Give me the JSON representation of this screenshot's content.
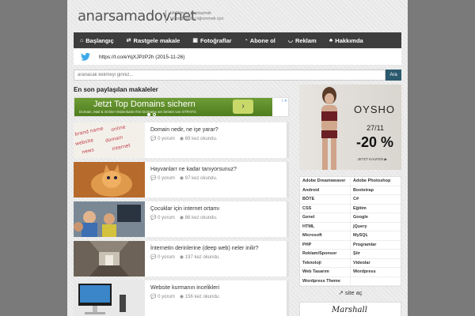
{
  "header": {
    "logo": "anarsamadov.net",
    "tagline_line1": "bildiklerini paylaşmak",
    "tagline_line2": "bilmediklerini öğrenmek için"
  },
  "nav": {
    "items": [
      {
        "label": "Başlangıç",
        "icon": "home-icon"
      },
      {
        "label": "Rastgele makale",
        "icon": "shuffle-icon"
      },
      {
        "label": "Fotoğraflar",
        "icon": "photo-icon"
      },
      {
        "label": "Abone ol",
        "icon": "rss-icon"
      },
      {
        "label": "Reklam",
        "icon": "megaphone-icon"
      },
      {
        "label": "Hakkımda",
        "icon": "users-icon"
      }
    ]
  },
  "tweet": {
    "text": "https://t.co/eYqXJPzP2h (2015-11-26)",
    "icon": "twitter-bird-icon"
  },
  "search": {
    "placeholder": "aranacak kelimeyi giriniz...",
    "button_label": "Ara"
  },
  "section_title": "En son paylaşılan makaleler",
  "ad_banner": {
    "title": "Jetzt Top Domains sichern",
    "subtitle": "Domain, Mail & Online-Visitenkarte Ihre Domains am besten von STRATO.",
    "arrow": "›",
    "corner": "i ✕"
  },
  "articles": [
    {
      "title": "Domain nedir, ne işe yarar?",
      "comments": "0 yorum",
      "reads": "69 kez okundu."
    },
    {
      "title": "Hayvanlarr ne kadar tanıyorsunuz?",
      "comments": "0 yorum",
      "reads": "97 kez okundu."
    },
    {
      "title": "Çocuklar için internet ortamı",
      "comments": "0 yorum",
      "reads": "86 kez okundu."
    },
    {
      "title": "İnternetin derinlerine (deep web) neler inilir?",
      "comments": "0 yorum",
      "reads": "197 kez okundu."
    },
    {
      "title": "Website kurmanın incelikleri",
      "comments": "0 yorum",
      "reads": "156 kez okundu."
    }
  ],
  "right_ad": {
    "brand": "OYSHO",
    "date": "27/11",
    "discount": "-20 %",
    "cta": "JETZT KAUFEN ▶"
  },
  "tags": [
    [
      "Adobe Dreamweaver",
      "Adobe Photoshop"
    ],
    [
      "Android",
      "Bootstrap"
    ],
    [
      "BÖTE",
      "C#"
    ],
    [
      "CSS",
      "Eğitim"
    ],
    [
      "Genel",
      "Google"
    ],
    [
      "HTML",
      "jQuery"
    ],
    [
      "Microsoft",
      "MySQL"
    ],
    [
      "PHP",
      "Programlar"
    ],
    [
      "Reklam/Sponsor",
      "Şiir"
    ],
    [
      "Teknoloji",
      "Videolar"
    ],
    [
      "Web Tasarım",
      "Wordpress"
    ],
    [
      "Wordpress Theme",
      ""
    ]
  ],
  "site_ac": "site aç",
  "bottom_ad": {
    "brand": "Marshall"
  }
}
